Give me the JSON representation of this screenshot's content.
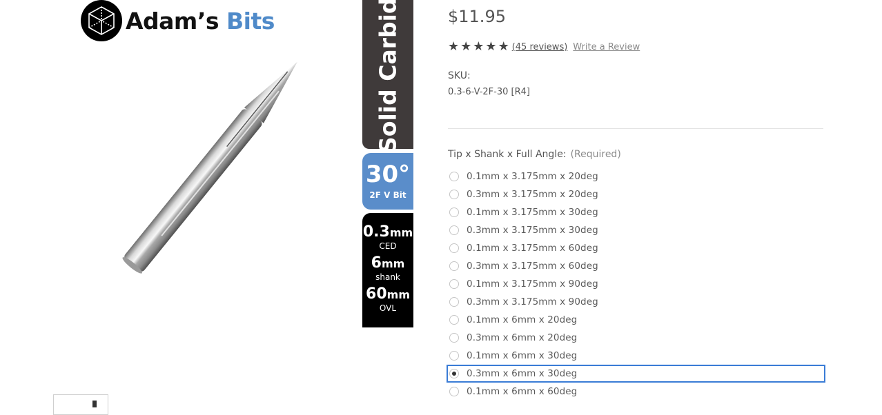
{
  "brand": {
    "word1": "Adam’s",
    "word2": "Bits"
  },
  "image_labels": {
    "material": "Solid Carbide",
    "angle": "30°",
    "angle_sub": "2F V Bit",
    "ced_value": "0.3",
    "ced_unit": "mm",
    "ced_label": "CED",
    "shank_value": "6",
    "shank_unit": "mm",
    "shank_label": "shank",
    "ovl_value": "60",
    "ovl_unit": "mm",
    "ovl_label": "OVL"
  },
  "product": {
    "price": "$11.95",
    "rating_stars": 5,
    "reviews_link": "(45 reviews)",
    "write_review": "Write a Review",
    "sku_label": "SKU:",
    "sku_value": "0.3-6-V-2F-30 [R4]"
  },
  "options": {
    "label": "Tip x Shank x Full Angle:",
    "required": "(Required)",
    "selected_index": 11,
    "items": [
      "0.1mm x 3.175mm x 20deg",
      "0.3mm x 3.175mm x 20deg",
      "0.1mm x 3.175mm x 30deg",
      "0.3mm x 3.175mm x 30deg",
      "0.1mm x 3.175mm x 60deg",
      "0.3mm x 3.175mm x 60deg",
      "0.1mm x 3.175mm x 90deg",
      "0.3mm x 3.175mm x 90deg",
      "0.1mm x 6mm x 20deg",
      "0.3mm x 6mm x 20deg",
      "0.1mm x 6mm x 30deg",
      "0.3mm x 6mm x 30deg",
      "0.1mm x 6mm x 60deg"
    ]
  },
  "colors": {
    "accent_blue": "#4f8ac9",
    "selection_border": "#3a7cd6",
    "dark_label": "#3f3a3a"
  }
}
